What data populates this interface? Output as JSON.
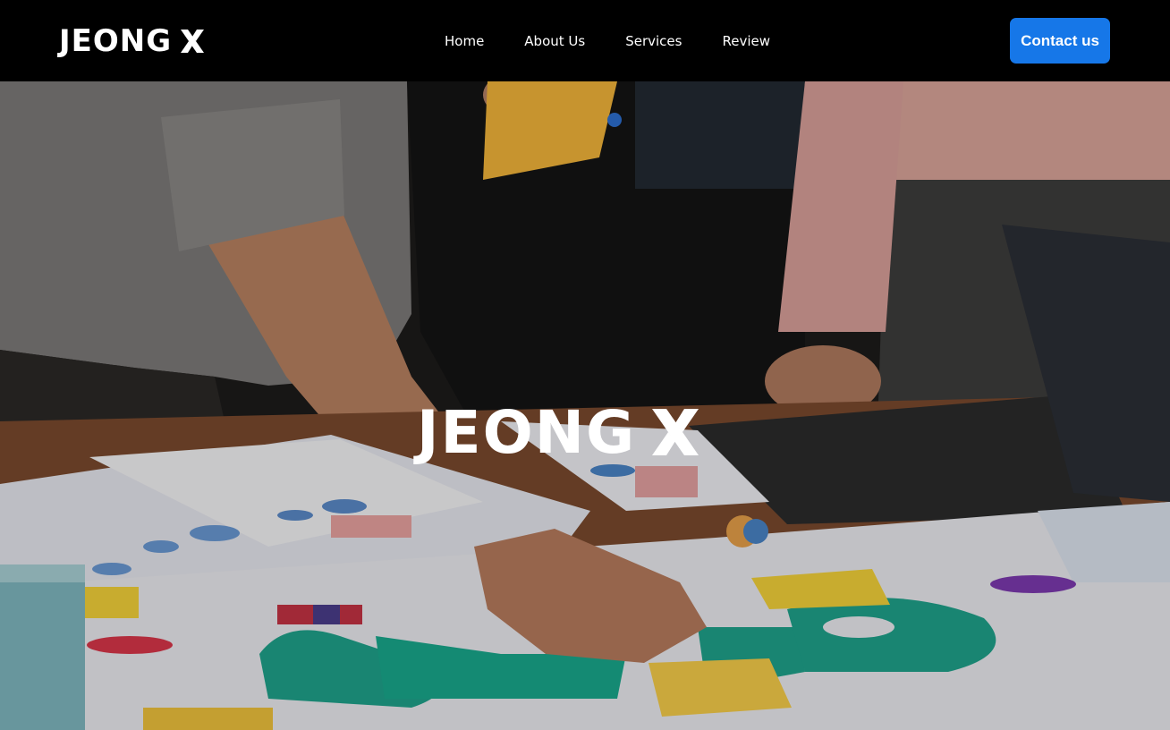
{
  "header": {
    "logo_text": "JEONG",
    "logo_mark_icon": "x-mark-icon",
    "nav": [
      {
        "label": "Home"
      },
      {
        "label": "About Us"
      },
      {
        "label": "Services"
      },
      {
        "label": "Review"
      }
    ],
    "contact_label": "Contact us"
  },
  "hero": {
    "logo_text": "JEONG",
    "logo_mark_icon": "x-mark-icon"
  },
  "colors": {
    "header_bg": "#000000",
    "accent": "#1677e8",
    "text": "#ffffff"
  }
}
